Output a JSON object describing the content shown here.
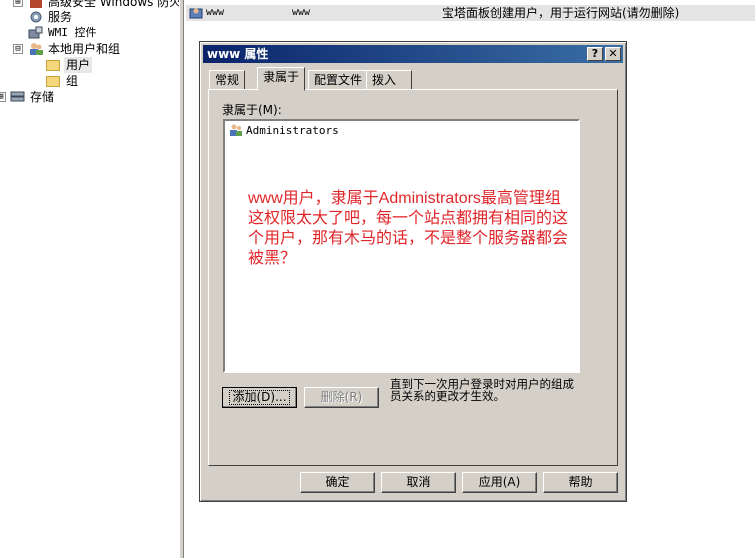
{
  "tree": {
    "items": [
      {
        "label": "高级安全 Windows 防火",
        "expander": "⊞"
      },
      {
        "label": "服务"
      },
      {
        "label": "WMI 控件"
      },
      {
        "label": "本地用户和组",
        "expander": "⊟"
      },
      {
        "label": "用户"
      },
      {
        "label": "组"
      },
      {
        "label": "存储",
        "expander": "⊞"
      }
    ]
  },
  "list": {
    "row_name": "www",
    "row_fullname": "www",
    "row_description": "宝塔面板创建用户，用于运行网站(请勿删除)",
    "cut_row_text": "www"
  },
  "dialog": {
    "title": "www 属性",
    "help_button": "?",
    "close_button": "✕",
    "tabs": [
      "常规",
      "隶属于",
      "配置文件",
      "拨入"
    ],
    "member_of_label": "隶属于(M):",
    "members": [
      "Administrators"
    ],
    "add_button": "添加(D)...",
    "remove_button": "删除(R)",
    "note": "直到下一次用户登录时对用户的组成员关系的更改才生效。",
    "ok_button": "确定",
    "cancel_button": "取消",
    "apply_button": "应用(A)",
    "help_button_label": "帮助"
  },
  "annotation": "www用户，隶属于Administrators最高管理组这权限太大了吧，每一个站点都拥有相同的这个用户，那有木马的话，不是整个服务器都会被黑？",
  "colors": {
    "title_bar": "#0a246a",
    "dialog_face": "#d4d0c8",
    "annotation_text": "#e0262a",
    "selected_row": "#e4e4e4"
  }
}
